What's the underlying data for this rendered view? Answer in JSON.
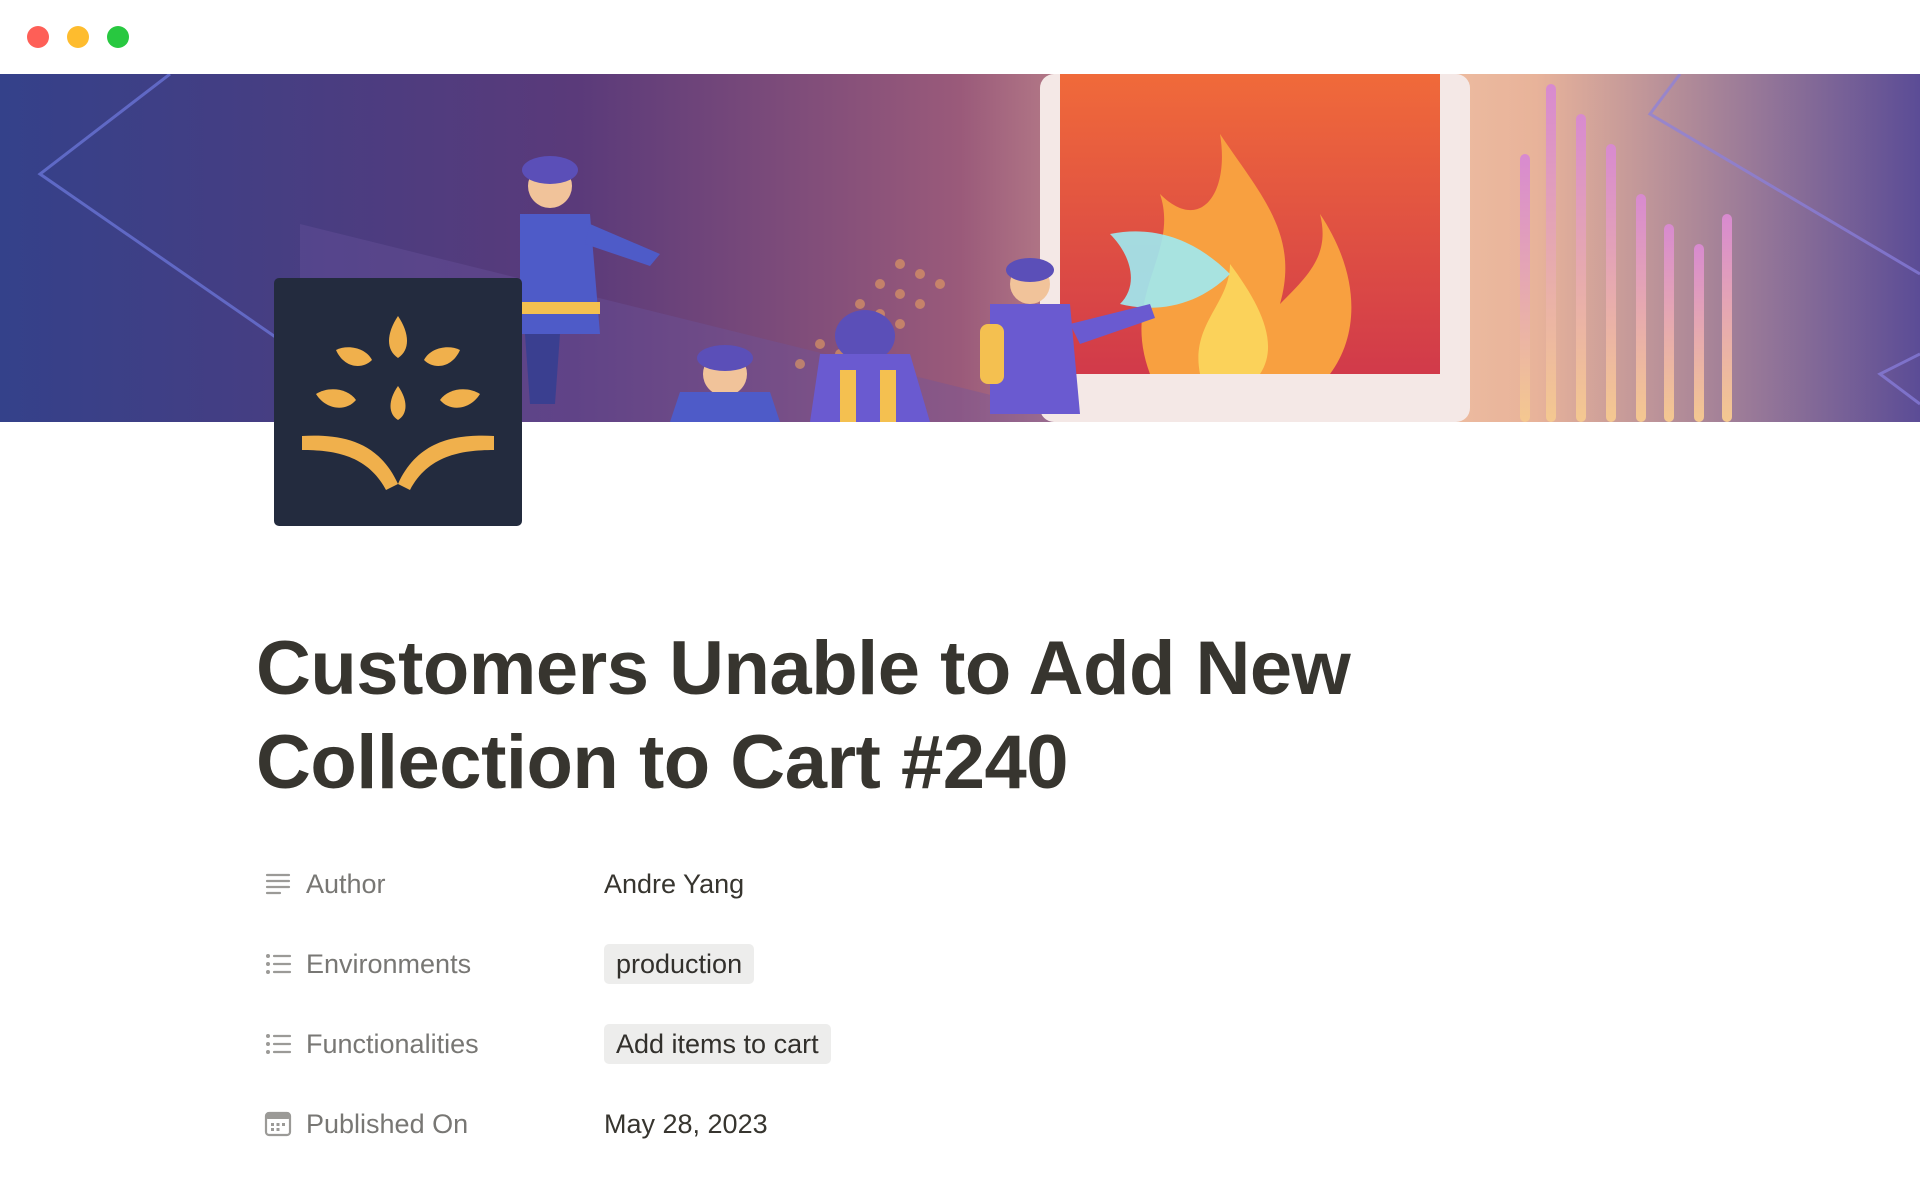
{
  "page": {
    "title": "Customers Unable to Add New Collection to Cart #240"
  },
  "properties": [
    {
      "name": "Author",
      "icon": "text-lines-icon",
      "value": "Andre Yang"
    },
    {
      "name": "Environments",
      "icon": "bulleted-list-icon",
      "tag": "production"
    },
    {
      "name": "Functionalities",
      "icon": "bulleted-list-icon",
      "tag": "Add items to cart"
    },
    {
      "name": "Published On",
      "icon": "calendar-icon",
      "value": "May 28, 2023"
    }
  ],
  "colors": {
    "traffic_red": "#fe5f57",
    "traffic_yellow": "#febc2e",
    "traffic_green": "#28c840",
    "icon_background": "#232b3e",
    "icon_accent": "#f0b04c",
    "tag_background": "#ededec",
    "label_color": "#787774",
    "text_color": "#37352f"
  }
}
